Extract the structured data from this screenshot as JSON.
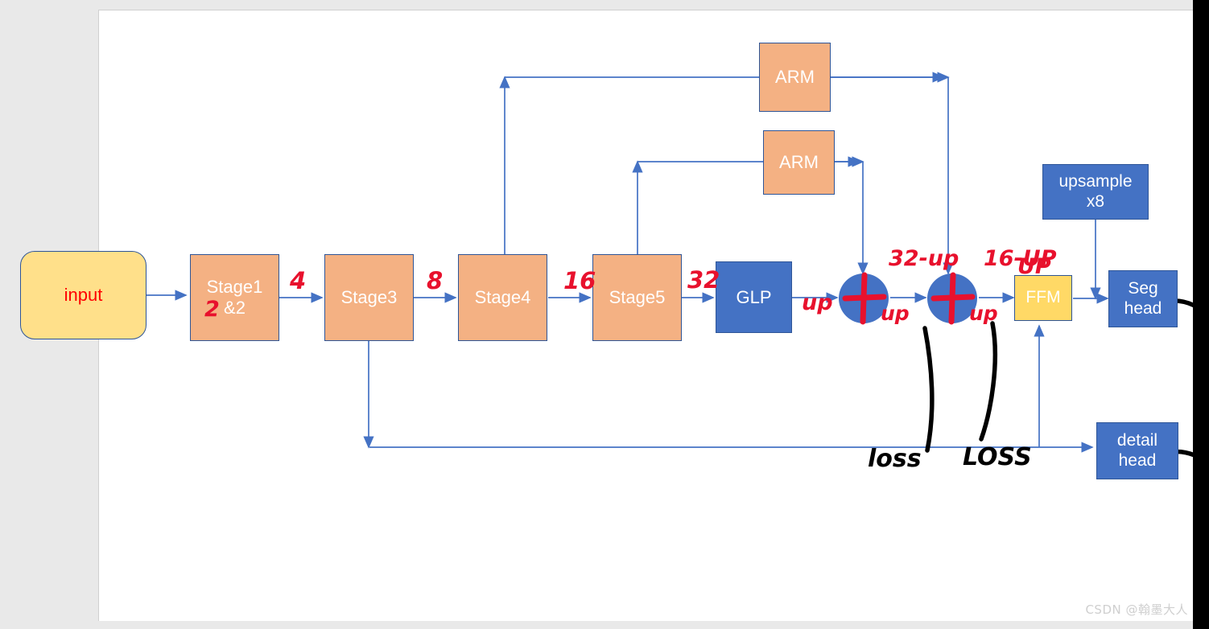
{
  "canvas": {
    "background": "#e9e9e9",
    "sheet_color": "#ffffff",
    "right_bar_color": "#000000"
  },
  "palette": {
    "orange": "#f4b183",
    "blue": "#4472c4",
    "yellow": "#ffd966",
    "input_yellow": "#ffe08a",
    "border_blue": "#2e5597",
    "arrow_blue": "#4472c4",
    "annotation_red": "#e8112d",
    "annotation_black": "#000000"
  },
  "nodes": {
    "input": {
      "label": "input",
      "shape": "rounded-rect",
      "color": "#ffe08a",
      "text_color": "#ff0000"
    },
    "stage12": {
      "label": "Stage1\n&2",
      "color": "#f4b183"
    },
    "stage3": {
      "label": "Stage3",
      "color": "#f4b183"
    },
    "stage4": {
      "label": "Stage4",
      "color": "#f4b183"
    },
    "stage5": {
      "label": "Stage5",
      "color": "#f4b183"
    },
    "glp": {
      "label": "GLP",
      "color": "#4472c4"
    },
    "arm_top": {
      "label": "ARM",
      "color": "#f4b183"
    },
    "arm_bottom": {
      "label": "ARM",
      "color": "#f4b183"
    },
    "add1": {
      "label": "+",
      "shape": "circle",
      "color": "#4472c4"
    },
    "add2": {
      "label": "+",
      "shape": "circle",
      "color": "#4472c4"
    },
    "ffm": {
      "label": "FFM",
      "color": "#ffd966"
    },
    "upsample": {
      "label": "upsample\nx8",
      "color": "#4472c4"
    },
    "seg_head": {
      "label": "Seg\nhead",
      "color": "#4472c4"
    },
    "detail_head": {
      "label": "detail\nhead",
      "color": "#4472c4"
    }
  },
  "annotations": {
    "red": [
      {
        "id": "stage1-overwrite-2",
        "text": "2"
      },
      {
        "id": "ds-4",
        "text": "4"
      },
      {
        "id": "ds-8",
        "text": "8"
      },
      {
        "id": "ds-16",
        "text": "16"
      },
      {
        "id": "ds-32",
        "text": "32"
      },
      {
        "id": "glp-up",
        "text": "up"
      },
      {
        "id": "add1-32up",
        "text": "32-up"
      },
      {
        "id": "add1-up",
        "text": "up"
      },
      {
        "id": "add2-16up",
        "text": "16-UP"
      },
      {
        "id": "add2-up",
        "text": "up"
      },
      {
        "id": "ffm-up",
        "text": "UP"
      }
    ],
    "black": [
      {
        "id": "loss-1",
        "text": "loss"
      },
      {
        "id": "loss-2",
        "text": "LOSS"
      }
    ]
  },
  "watermark": {
    "text": "CSDN @翰墨大人"
  }
}
